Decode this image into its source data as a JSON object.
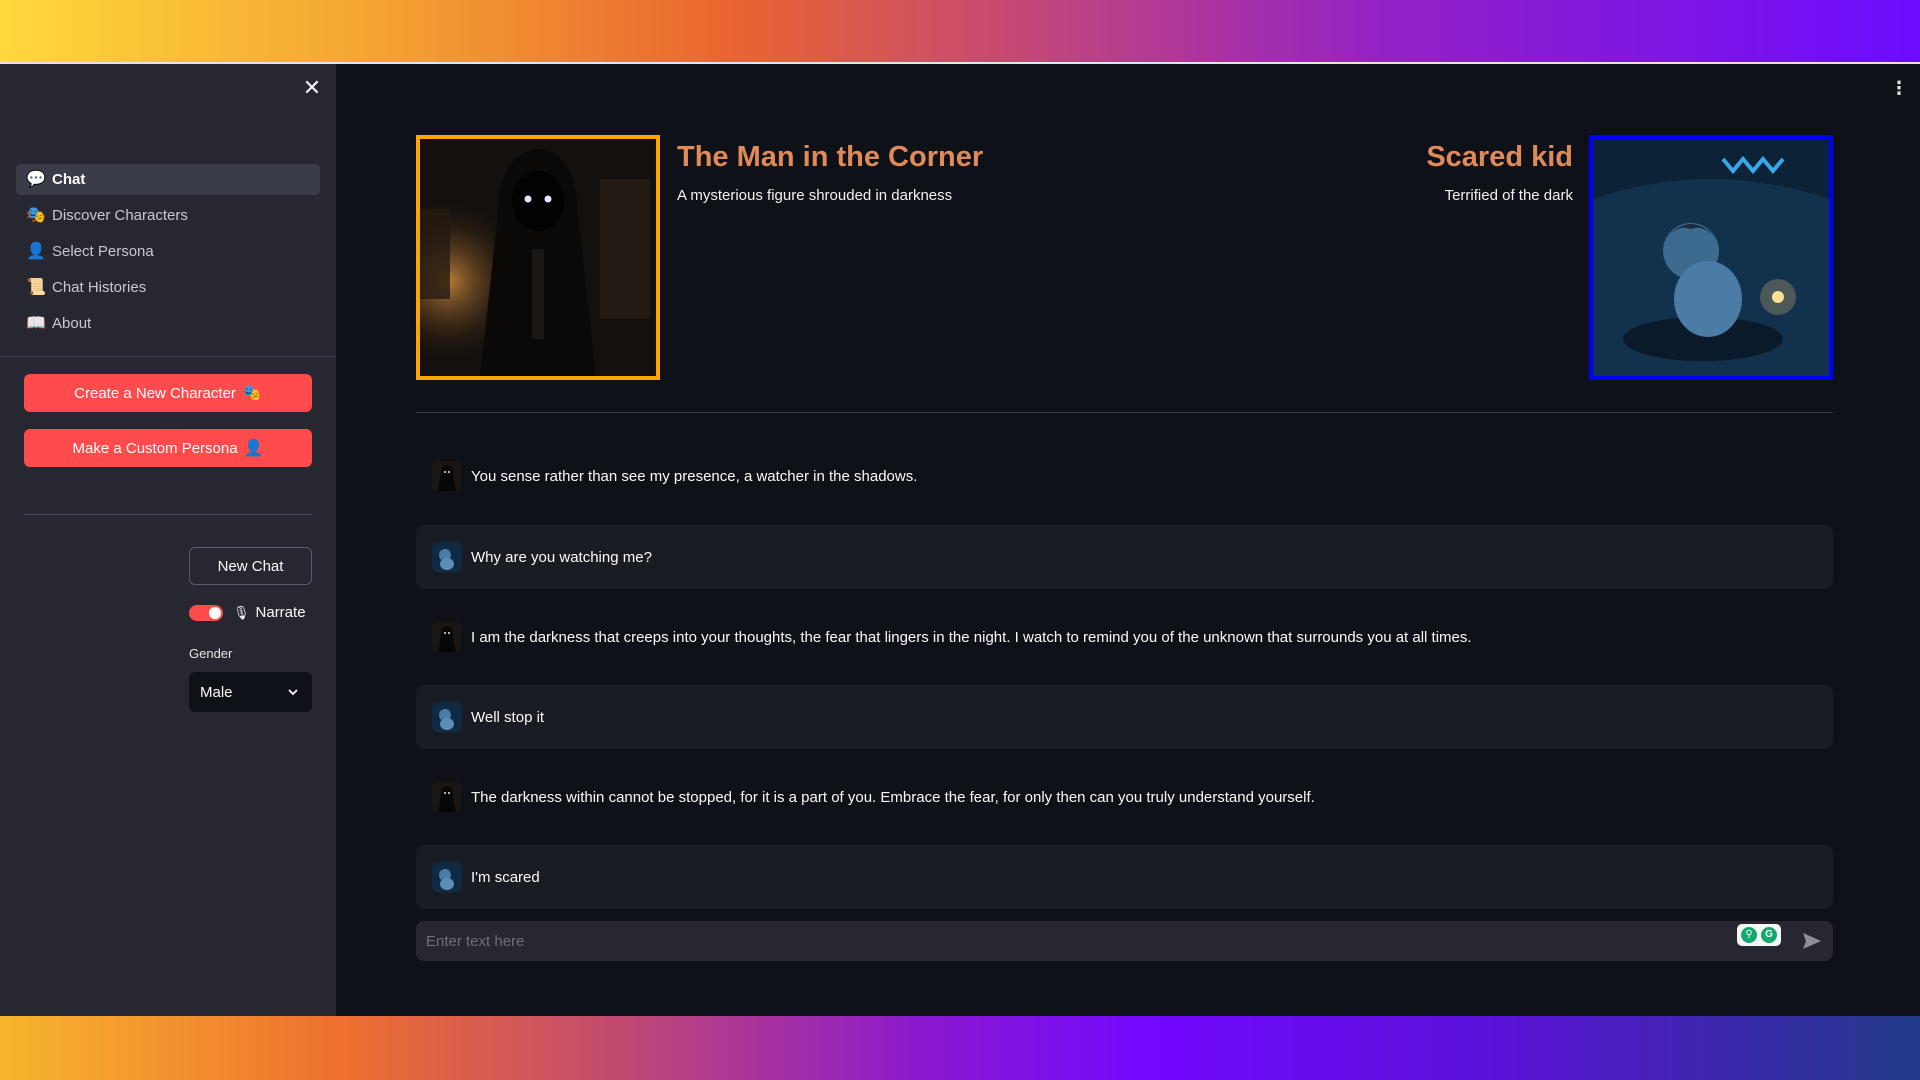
{
  "sidebar": {
    "nav": [
      {
        "label": "Chat",
        "icon": "speech-balloon-icon",
        "glyph": "💬",
        "active": true
      },
      {
        "label": "Discover Characters",
        "icon": "theater-masks-icon",
        "glyph": "🎭",
        "active": false
      },
      {
        "label": "Select Persona",
        "icon": "person-silhouette-icon",
        "glyph": "👤",
        "active": false
      },
      {
        "label": "Chat Histories",
        "icon": "scroll-icon",
        "glyph": "📜",
        "active": false
      },
      {
        "label": "About",
        "icon": "open-book-icon",
        "glyph": "📖",
        "active": false
      }
    ],
    "create_character_label": "Create a New Character",
    "create_character_emoji": "🎭",
    "custom_persona_label": "Make a Custom Persona",
    "custom_persona_emoji": "👤",
    "new_chat_label": "New Chat",
    "narrate": {
      "label": "Narrate",
      "enabled": true,
      "icon": "microphone-icon"
    },
    "gender": {
      "label": "Gender",
      "value": "Male"
    }
  },
  "characters": {
    "ai": {
      "name": "The Man in the Corner",
      "description": "A mysterious figure shrouded in darkness",
      "border_color": "#ffa500"
    },
    "user": {
      "name": "Scared kid",
      "description": "Terrified of the dark",
      "border_color": "#0000ff"
    }
  },
  "messages": [
    {
      "role": "ai",
      "text": "You sense rather than see my presence, a watcher in the shadows."
    },
    {
      "role": "user",
      "text": "Why are you watching me?"
    },
    {
      "role": "ai",
      "text": "I am the darkness that creeps into your thoughts, the fear that lingers in the night. I watch to remind you of the unknown that surrounds you at all times."
    },
    {
      "role": "user",
      "text": "Well stop it"
    },
    {
      "role": "ai",
      "text": "The darkness within cannot be stopped, for it is a part of you. Embrace the fear, for only then can you truly understand yourself."
    },
    {
      "role": "user",
      "text": "I'm scared"
    }
  ],
  "chat_input": {
    "placeholder": "Enter text here",
    "value": ""
  },
  "colors": {
    "accent": "#ff4b4b",
    "name_color": "#e08a5a",
    "background": "#0e1117",
    "sidebar": "#262730"
  }
}
